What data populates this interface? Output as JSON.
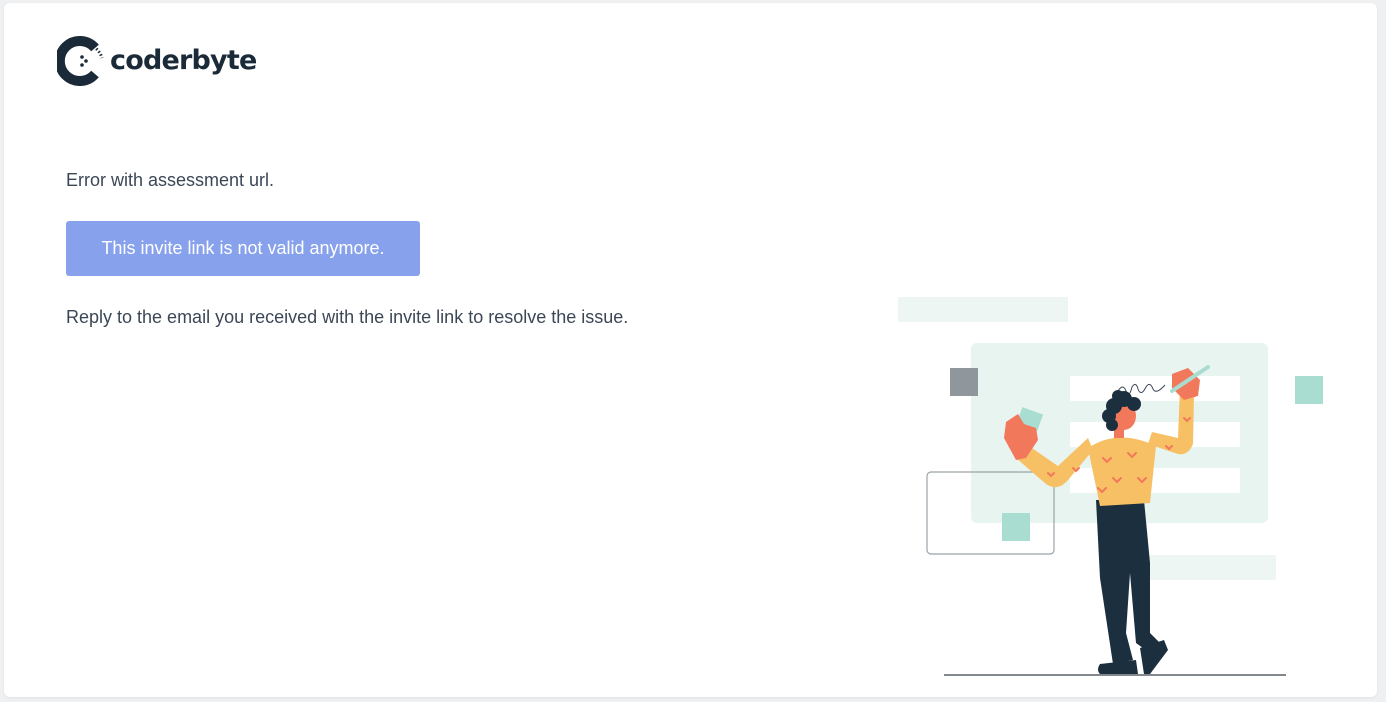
{
  "brand": {
    "name": "coderbyte",
    "logo_icon": "coderbyte-c-icon",
    "text_color": "#1b2a38"
  },
  "error": {
    "title": "Error with assessment url.",
    "banner": "This invite link is not valid anymore.",
    "instruction": "Reply to the email you received with the invite link to resolve the issue."
  },
  "colors": {
    "banner_bg": "#87a1ec",
    "text": "#3c4756",
    "illustration_accent": "#f2785c",
    "illustration_shirt": "#f8c064",
    "illustration_dark": "#1b2f3e",
    "illustration_mint": "#a9ddd2"
  },
  "illustration": {
    "name": "person-signing-document-illustration"
  }
}
